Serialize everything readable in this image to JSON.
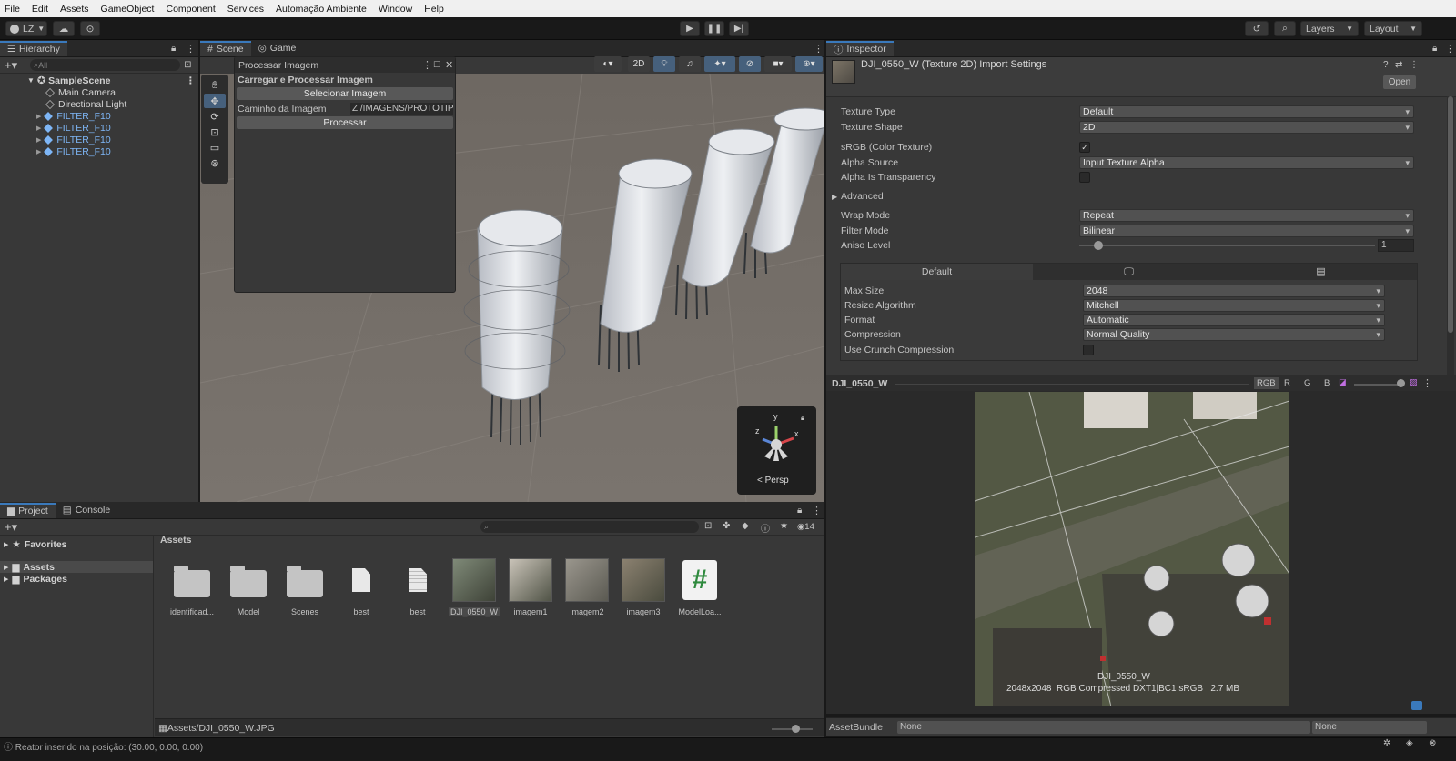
{
  "menu": [
    "File",
    "Edit",
    "Assets",
    "GameObject",
    "Component",
    "Services",
    "Automação Ambiente",
    "Window",
    "Help"
  ],
  "toolbar": {
    "account": "LZ",
    "layers": "Layers",
    "layout": "Layout",
    "play_icon": "play-icon",
    "pause_icon": "pause-icon",
    "step_icon": "step-icon"
  },
  "hierarchy": {
    "title": "Hierarchy",
    "search_placeholder": "All",
    "scene": "SampleScene",
    "items": [
      {
        "label": "Main Camera",
        "icon": "camera-icon"
      },
      {
        "label": "Directional Light",
        "icon": "light-icon"
      },
      {
        "label": "FILTER_F10",
        "icon": "prefab-icon"
      },
      {
        "label": "FILTER_F10",
        "icon": "prefab-icon"
      },
      {
        "label": "FILTER_F10",
        "icon": "prefab-icon"
      },
      {
        "label": "FILTER_F10",
        "icon": "prefab-icon"
      }
    ]
  },
  "scene": {
    "tabs": [
      "Scene",
      "Game"
    ],
    "mode_2d": "2D",
    "persp": "< Persp",
    "gizmo_axes": {
      "y": "y",
      "x": "x",
      "z": "z"
    },
    "overlay": {
      "title": "Processar Imagem",
      "section": "Carregar e Processar Imagem",
      "select_button": "Selecionar Imagem",
      "path_label": "Caminho da Imagem",
      "path_value": "Z:/IMAGENS/PROTOTIP",
      "process_button": "Processar"
    }
  },
  "inspector": {
    "tab": "Inspector",
    "title": "DJI_0550_W (Texture 2D) Import Settings",
    "open_button": "Open",
    "fields": [
      {
        "label": "Texture Type",
        "value": "Default"
      },
      {
        "label": "Texture Shape",
        "value": "2D"
      },
      {
        "label": "sRGB (Color Texture)",
        "checked": true
      },
      {
        "label": "Alpha Source",
        "value": "Input Texture Alpha"
      },
      {
        "label": "Alpha Is Transparency",
        "checked": false
      }
    ],
    "advanced": "Advanced",
    "fields2": [
      {
        "label": "Wrap Mode",
        "value": "Repeat"
      },
      {
        "label": "Filter Mode",
        "value": "Bilinear"
      }
    ],
    "aniso": {
      "label": "Aniso Level",
      "value": "1",
      "level": 0.05
    },
    "platform": {
      "default_tab": "Default",
      "fields": [
        {
          "label": "Max Size",
          "value": "2048"
        },
        {
          "label": "Resize Algorithm",
          "value": "Mitchell"
        },
        {
          "label": "Format",
          "value": "Automatic"
        },
        {
          "label": "Compression",
          "value": "Normal Quality"
        }
      ],
      "crunch": {
        "label": "Use Crunch Compression",
        "checked": false
      }
    },
    "preview": {
      "name": "DJI_0550_W",
      "channels": [
        "RGB",
        "R",
        "G",
        "B"
      ],
      "caption_name": "DJI_0550_W",
      "caption_info": "2048x2048  RGB Compressed DXT1|BC1 sRGB   2.7 MB"
    },
    "assetbundle": {
      "label": "AssetBundle",
      "value": "None",
      "variant": "None"
    }
  },
  "project": {
    "tabs": [
      "Project",
      "Console"
    ],
    "favorites": "Favorites",
    "tree": [
      "Assets",
      "Packages"
    ],
    "breadcrumb": "Assets",
    "count": "14",
    "assets": [
      {
        "label": "identificad...",
        "kind": "folder"
      },
      {
        "label": "Model",
        "kind": "folder"
      },
      {
        "label": "Scenes",
        "kind": "folder"
      },
      {
        "label": "best",
        "kind": "doc"
      },
      {
        "label": "best",
        "kind": "doc"
      },
      {
        "label": "DJI_0550_W",
        "kind": "image"
      },
      {
        "label": "imagem1",
        "kind": "image"
      },
      {
        "label": "imagem2",
        "kind": "image"
      },
      {
        "label": "imagem3",
        "kind": "image"
      },
      {
        "label": "ModelLoa...",
        "kind": "script"
      }
    ],
    "path": "Assets/DJI_0550_W.JPG"
  },
  "status": "Reator inserido na posição: (30.00, 0.00, 0.00)",
  "colors": {
    "accent": "#3a79bb",
    "prefab": "#7eb6f6",
    "panel": "#383838",
    "header": "#282828",
    "scene_ground": "#77716b"
  }
}
